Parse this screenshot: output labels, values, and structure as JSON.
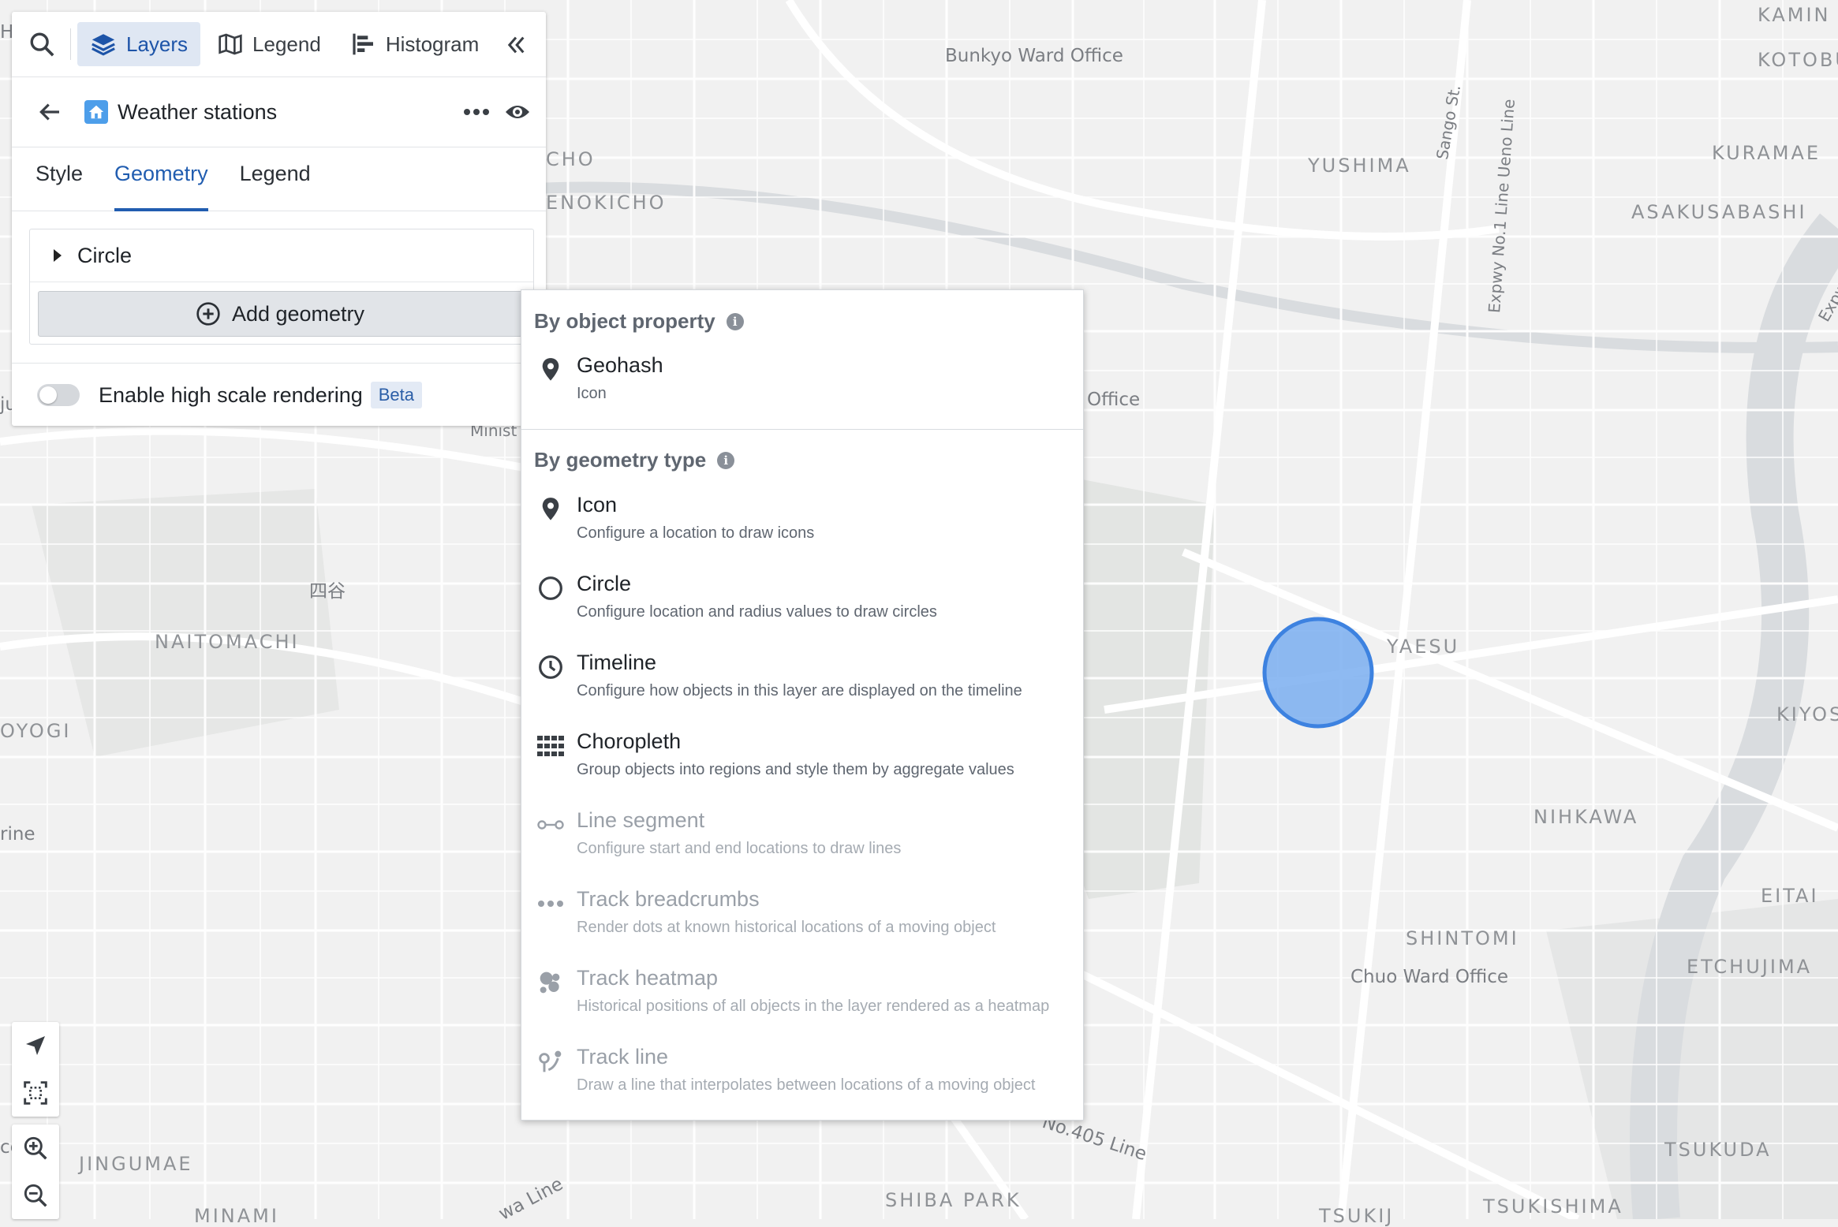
{
  "toolbar": {
    "tabs": [
      {
        "label": "Layers",
        "active": true,
        "icon": "layers-icon"
      },
      {
        "label": "Legend",
        "active": false,
        "icon": "map-icon"
      },
      {
        "label": "Histogram",
        "active": false,
        "icon": "histogram-icon"
      }
    ]
  },
  "layer": {
    "name": "Weather stations"
  },
  "layer_tabs": [
    {
      "label": "Style",
      "active": false
    },
    {
      "label": "Geometry",
      "active": true
    },
    {
      "label": "Legend",
      "active": false
    }
  ],
  "geometry": {
    "items": [
      {
        "label": "Circle"
      }
    ],
    "add_label": "Add geometry"
  },
  "high_scale": {
    "label": "Enable high scale rendering",
    "badge": "Beta",
    "enabled": false
  },
  "menu": {
    "by_property": {
      "header": "By object property",
      "items": [
        {
          "title": "Geohash",
          "subtitle": "Icon",
          "icon": "pin-icon",
          "disabled": false
        }
      ]
    },
    "by_type": {
      "header": "By geometry type",
      "items": [
        {
          "title": "Icon",
          "subtitle": "Configure a location to draw icons",
          "icon": "pin-icon",
          "disabled": false
        },
        {
          "title": "Circle",
          "subtitle": "Configure location and radius values to draw circles",
          "icon": "circle-icon",
          "disabled": false
        },
        {
          "title": "Timeline",
          "subtitle": "Configure how objects in this layer are displayed on the timeline",
          "icon": "clock-icon",
          "disabled": false
        },
        {
          "title": "Choropleth",
          "subtitle": "Group objects into regions and style them by aggregate values",
          "icon": "grid-icon",
          "disabled": false
        },
        {
          "title": "Line segment",
          "subtitle": "Configure start and end locations to draw lines",
          "icon": "line-segment-icon",
          "disabled": true
        },
        {
          "title": "Track breadcrumbs",
          "subtitle": "Render dots at known historical locations of a moving object",
          "icon": "dots-icon",
          "disabled": true
        },
        {
          "title": "Track heatmap",
          "subtitle": "Historical positions of all objects in the layer rendered as a heatmap",
          "icon": "heatmap-icon",
          "disabled": true
        },
        {
          "title": "Track line",
          "subtitle": "Draw a line that interpolates between locations of a moving object",
          "icon": "track-line-icon",
          "disabled": true
        }
      ]
    }
  },
  "map": {
    "labels": [
      "Bunkyo Ward Office",
      "YUSHIMA",
      "KURAMAE",
      "ASAKUSABASHI",
      "KAMIN",
      "KOTOBU",
      "CHO",
      "ENOKICHO",
      "Sango St.",
      "Expwy No.1 Line Ueno Line",
      "Expw",
      "Office",
      "Minist",
      "YAESU",
      "KIYOS",
      "NIHKAWA",
      "EITAI",
      "SHINTOMI",
      "Chuo Ward Office",
      "ETCHUJIMA",
      "TSUKUDA",
      "TSUKISHIMA",
      "SHIBA PARK",
      "JINGUMAE",
      "MINAMI",
      "NAITOMACHI",
      "四谷",
      "OYOGI",
      "rine",
      "ce",
      "No.405 Line",
      "wa Line",
      "TSUKIJ",
      "ju",
      "H"
    ]
  },
  "colors": {
    "accent": "#215db0",
    "circle_fill": "#7aaef0",
    "circle_stroke": "#3d82e0"
  }
}
